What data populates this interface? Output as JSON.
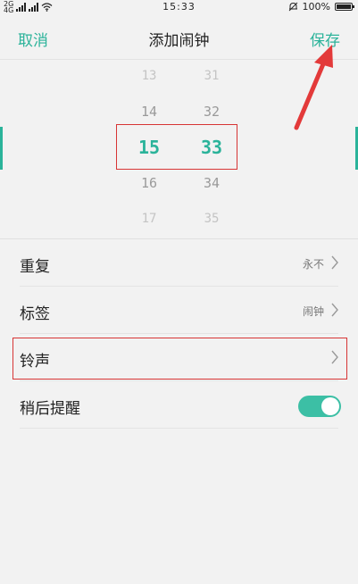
{
  "status_bar": {
    "network_top": "2G",
    "network_bottom": "4G",
    "time": "15:33",
    "battery_text": "100%",
    "battery_level": 1.0
  },
  "header": {
    "cancel_label": "取消",
    "title": "添加闹钟",
    "save_label": "保存"
  },
  "picker": {
    "hours": [
      "13",
      "14",
      "15",
      "16",
      "17"
    ],
    "minutes": [
      "31",
      "32",
      "33",
      "34",
      "35"
    ],
    "selected_hour": "15",
    "selected_minute": "33"
  },
  "settings": {
    "repeat": {
      "label": "重复",
      "value": "永不"
    },
    "tag": {
      "label": "标签",
      "value": "闹钟"
    },
    "ringtone": {
      "label": "铃声"
    },
    "snooze": {
      "label": "稍后提醒",
      "enabled": true
    }
  },
  "colors": {
    "accent": "#2bb39a",
    "toggle_on": "#3cbfa5",
    "annotation": "#d73535",
    "background": "#f2f2f2"
  }
}
